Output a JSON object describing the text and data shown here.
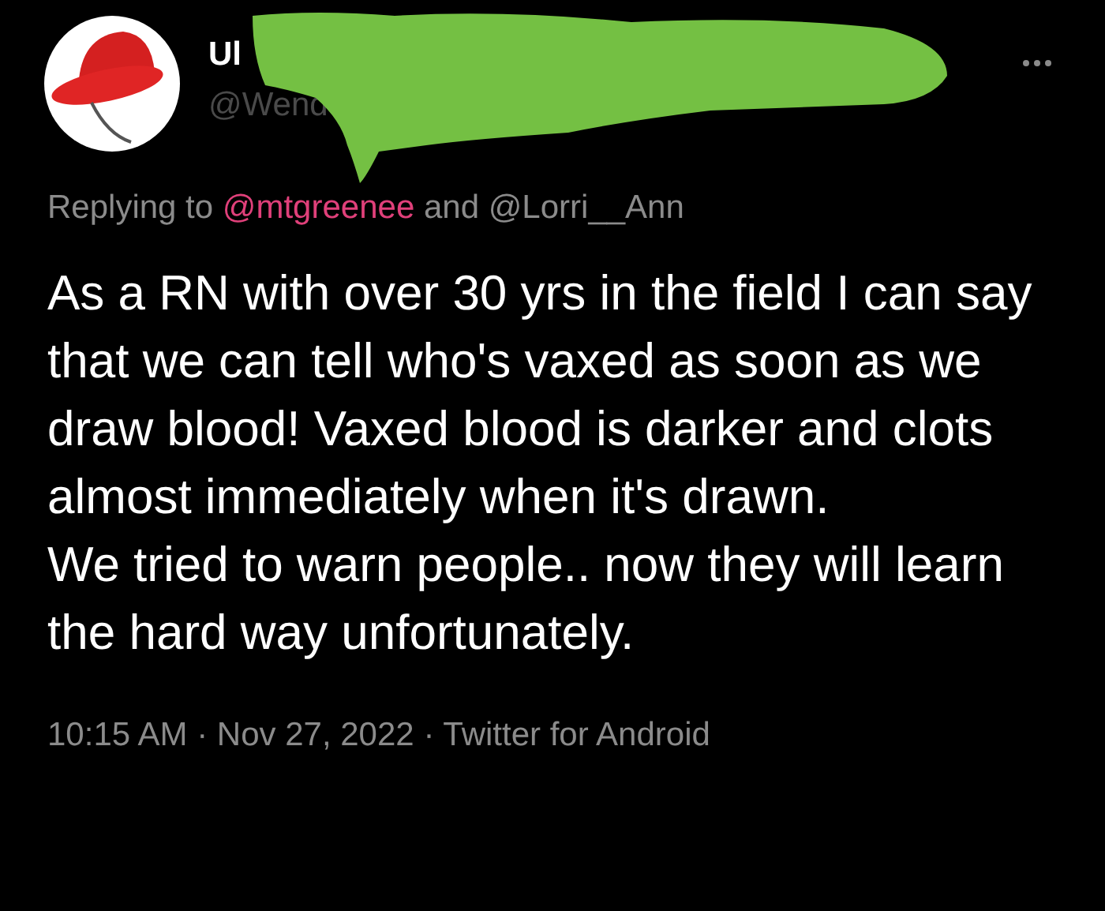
{
  "tweet": {
    "name_visible": "Ul",
    "handle_visible": "@Wend",
    "replying": {
      "prefix": "Replying to",
      "mentions": [
        "@mtgreenee",
        "@Lorri__Ann"
      ],
      "joiner": "and"
    },
    "paragraphs": [
      "As a RN with over 30 yrs in the field I can say that we can tell who's vaxed as soon as we draw blood! Vaxed blood is darker and clots almost immediately when it's drawn.",
      "We tried to warn people.. now they will learn the hard way unfortunately."
    ],
    "time": "10:15 AM",
    "date": "Nov 27, 2022",
    "source": "Twitter for Android",
    "separator": "·"
  }
}
